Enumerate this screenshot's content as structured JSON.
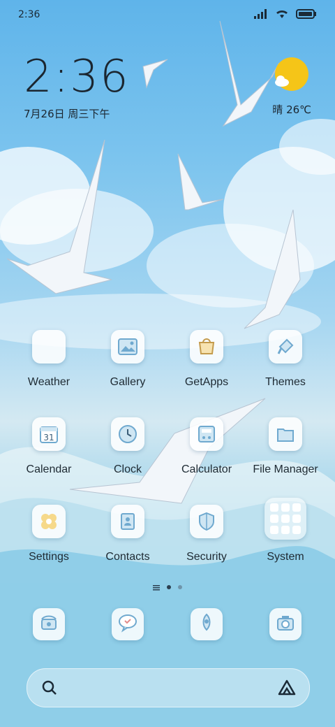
{
  "status_bar": {
    "time": "2:36"
  },
  "clock_widget": {
    "time": "2:36",
    "date": "7月26日 周三下午"
  },
  "weather_widget": {
    "text": "晴 26℃"
  },
  "apps": [
    {
      "label": "Weather",
      "icon": "weather-icon"
    },
    {
      "label": "Gallery",
      "icon": "gallery-icon"
    },
    {
      "label": "GetApps",
      "icon": "getapps-icon"
    },
    {
      "label": "Themes",
      "icon": "themes-icon"
    },
    {
      "label": "Calendar",
      "icon": "calendar-icon",
      "day": "31"
    },
    {
      "label": "Clock",
      "icon": "clock-icon"
    },
    {
      "label": "Calculator",
      "icon": "calculator-icon"
    },
    {
      "label": "File Manager",
      "icon": "file-manager-icon"
    },
    {
      "label": "Settings",
      "icon": "settings-icon"
    },
    {
      "label": "Contacts",
      "icon": "contacts-icon"
    },
    {
      "label": "Security",
      "icon": "security-icon"
    },
    {
      "label": "System",
      "icon": "folder-icon"
    }
  ],
  "dock": [
    {
      "icon": "phone-icon"
    },
    {
      "icon": "messages-icon"
    },
    {
      "icon": "browser-icon"
    },
    {
      "icon": "camera-icon"
    }
  ],
  "colors": {
    "sky": "#5fb4ea",
    "sun": "#f5c518",
    "icon_tint": "#6fa9cf"
  }
}
